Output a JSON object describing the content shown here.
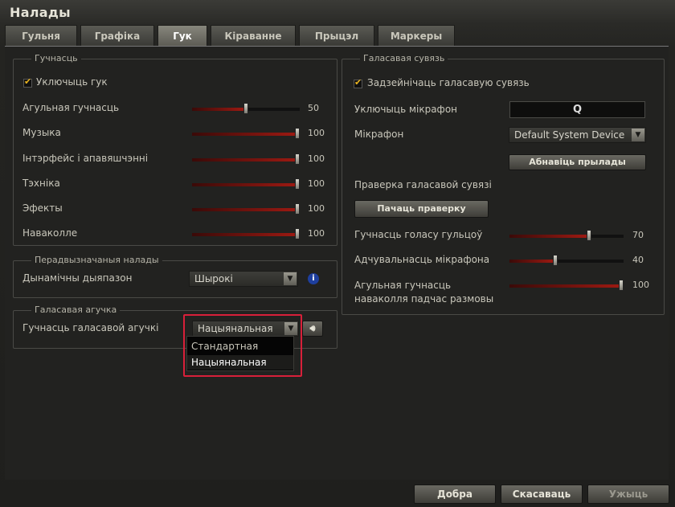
{
  "window": {
    "title": "Налады"
  },
  "tabs": [
    {
      "label": "Гульня",
      "active": false
    },
    {
      "label": "Графіка",
      "active": false
    },
    {
      "label": "Гук",
      "active": true
    },
    {
      "label": "Кіраванне",
      "active": false
    },
    {
      "label": "Прыцэл",
      "active": false
    },
    {
      "label": "Маркеры",
      "active": false
    }
  ],
  "volume": {
    "title": "Гучнасць",
    "enable_sound": {
      "label": "Уключыць гук",
      "checked": true
    },
    "sliders": [
      {
        "label": "Агульная гучнасць",
        "value": "50",
        "fraction": 0.5
      },
      {
        "label": "Музыка",
        "value": "100",
        "fraction": 1.0
      },
      {
        "label": "Інтэрфейс і апавяшчэнні",
        "value": "100",
        "fraction": 1.0
      },
      {
        "label": "Тэхніка",
        "value": "100",
        "fraction": 1.0
      },
      {
        "label": "Эфекты",
        "value": "100",
        "fraction": 1.0
      },
      {
        "label": "Наваколле",
        "value": "100",
        "fraction": 1.0
      }
    ]
  },
  "presets": {
    "title": "Перадвызначаныя налады",
    "dynamic_range": {
      "label": "Дынамічны дыяпазон",
      "value": "Шырокі"
    }
  },
  "voice_guide": {
    "title": "Галасавая агучка",
    "label": "Гучнасць галасавой агучкі",
    "value": "Нацыянальная",
    "options": [
      "Стандартная",
      "Нацыянальная"
    ],
    "selected_option": "Нацыянальная",
    "accent_color": "#d8203a"
  },
  "voice_chat": {
    "title": "Галасавая сувязь",
    "enable": {
      "label": "Задзейнічаць галасавую сувязь",
      "checked": true
    },
    "mic_key": {
      "label": "Уключыць мікрафон",
      "value": "Q"
    },
    "microphone": {
      "label": "Мікрафон",
      "value": "Default System Device"
    },
    "refresh_button": "Абнавіць прылады",
    "test_label": "Праверка галасавой сувязі",
    "test_button": "Пачаць праверку",
    "sliders": [
      {
        "label": "Гучнасць голасу гульцоў",
        "value": "70",
        "fraction": 0.7
      },
      {
        "label": "Адчувальнасць мікрафона",
        "value": "40",
        "fraction": 0.4
      },
      {
        "label": "Агульная гучнасць наваколля падчас размовы",
        "value": "100",
        "fraction": 1.0
      }
    ]
  },
  "footer": {
    "ok": "Добра",
    "cancel": "Скасаваць",
    "apply": "Ужыць"
  }
}
